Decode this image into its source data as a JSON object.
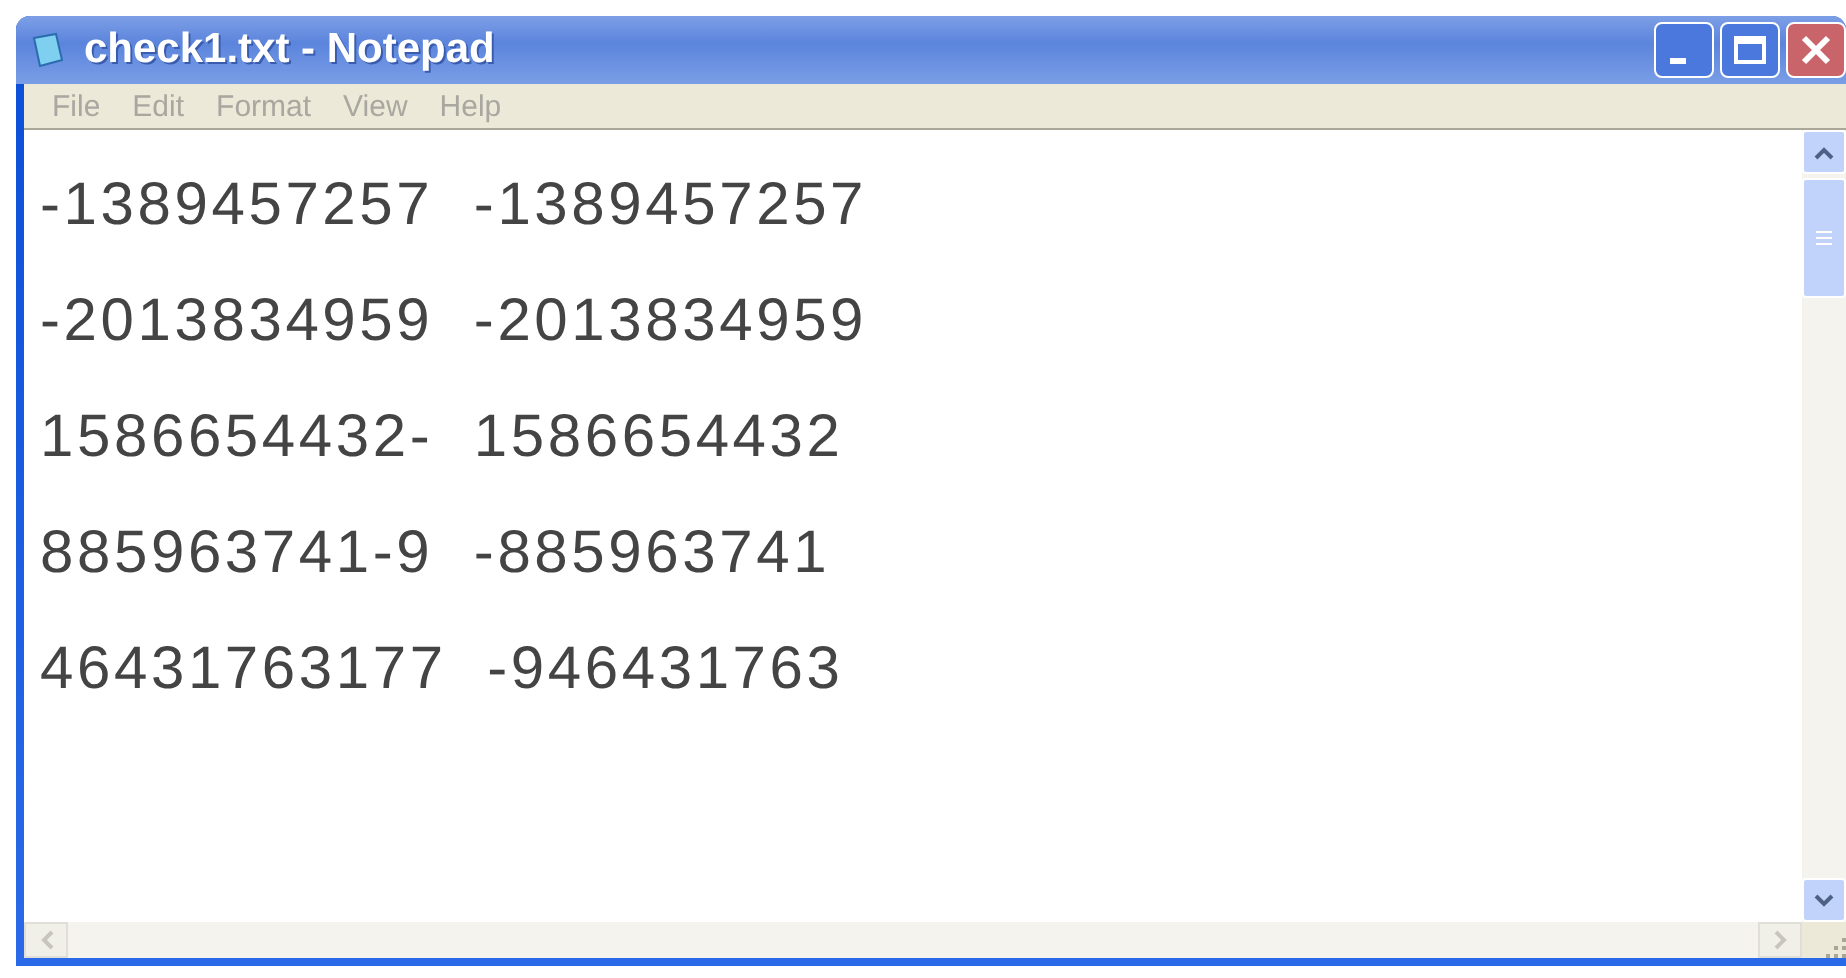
{
  "window": {
    "title": "check1.txt - Notepad"
  },
  "menu": [
    "File",
    "Edit",
    "Format",
    "View",
    "Help"
  ],
  "lines": [
    "-1389457257  -1389457257",
    "-2013834959  -2013834959",
    "1586654432-  1586654432",
    "885963741-9  -885963741",
    "46431763177  -946431763"
  ]
}
